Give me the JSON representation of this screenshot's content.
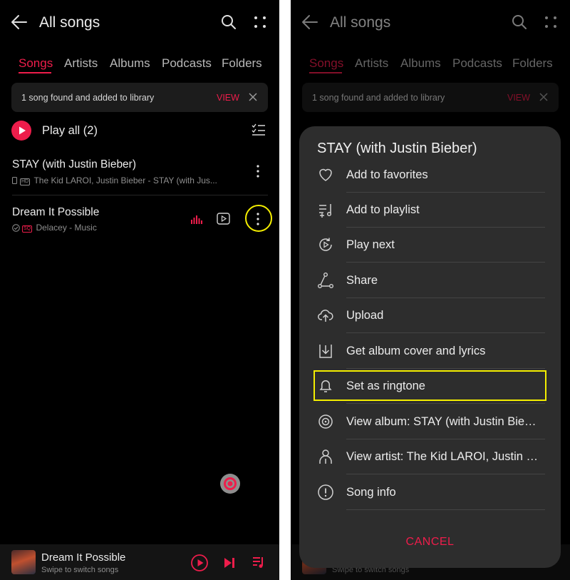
{
  "header": {
    "back_icon": "arrow-left-icon",
    "title": "All songs",
    "search_icon": "search-icon",
    "more_icon": "more-grid-icon"
  },
  "tabs": [
    {
      "label": "Songs",
      "active": true
    },
    {
      "label": "Artists",
      "active": false
    },
    {
      "label": "Albums",
      "active": false
    },
    {
      "label": "Podcasts",
      "active": false
    },
    {
      "label": "Folders",
      "active": false
    }
  ],
  "banner": {
    "text": "1 song found and added to library",
    "view": "VIEW",
    "close_icon": "close-icon"
  },
  "play_all": {
    "label": "Play all (2)",
    "icon": "play-circle-icon",
    "multiselect_icon": "checklist-icon"
  },
  "songs": [
    {
      "title": "STAY (with Justin Bieber)",
      "badge": "HD",
      "subtitle": "The Kid LAROI, Justin Bieber - STAY (with Jus...",
      "source_icon": "phone-icon"
    },
    {
      "title": "Dream It Possible",
      "badge": "SQ",
      "subtitle": "Delacey - Music",
      "source_icon": "check-circle-icon"
    }
  ],
  "player": {
    "title": "Dream It Possible",
    "subtitle": "Swipe to switch songs",
    "play_icon": "play-icon",
    "next_icon": "next-icon",
    "queue_icon": "playlist-icon"
  },
  "sheet": {
    "title": "STAY (with Justin Bieber)",
    "items": [
      {
        "label": "Add to favorites",
        "icon": "heart-icon"
      },
      {
        "label": "Add to playlist",
        "icon": "add-playlist-icon"
      },
      {
        "label": "Play next",
        "icon": "play-next-icon"
      },
      {
        "label": "Share",
        "icon": "share-icon"
      },
      {
        "label": "Upload",
        "icon": "upload-cloud-icon"
      },
      {
        "label": "Get album cover and lyrics",
        "icon": "download-icon"
      },
      {
        "label": "Set as ringtone",
        "icon": "bell-icon"
      },
      {
        "label": "View album: STAY (with Justin Bieber)",
        "icon": "disc-icon"
      },
      {
        "label": "View artist: The Kid LAROI, Justin Bieber",
        "icon": "person-icon"
      },
      {
        "label": "Song info",
        "icon": "info-icon"
      }
    ],
    "cancel": "CANCEL"
  },
  "colors": {
    "accent": "#ee1d4b",
    "background": "#000000",
    "sheet": "#2d2d2d",
    "highlight": "#f4ee00"
  }
}
